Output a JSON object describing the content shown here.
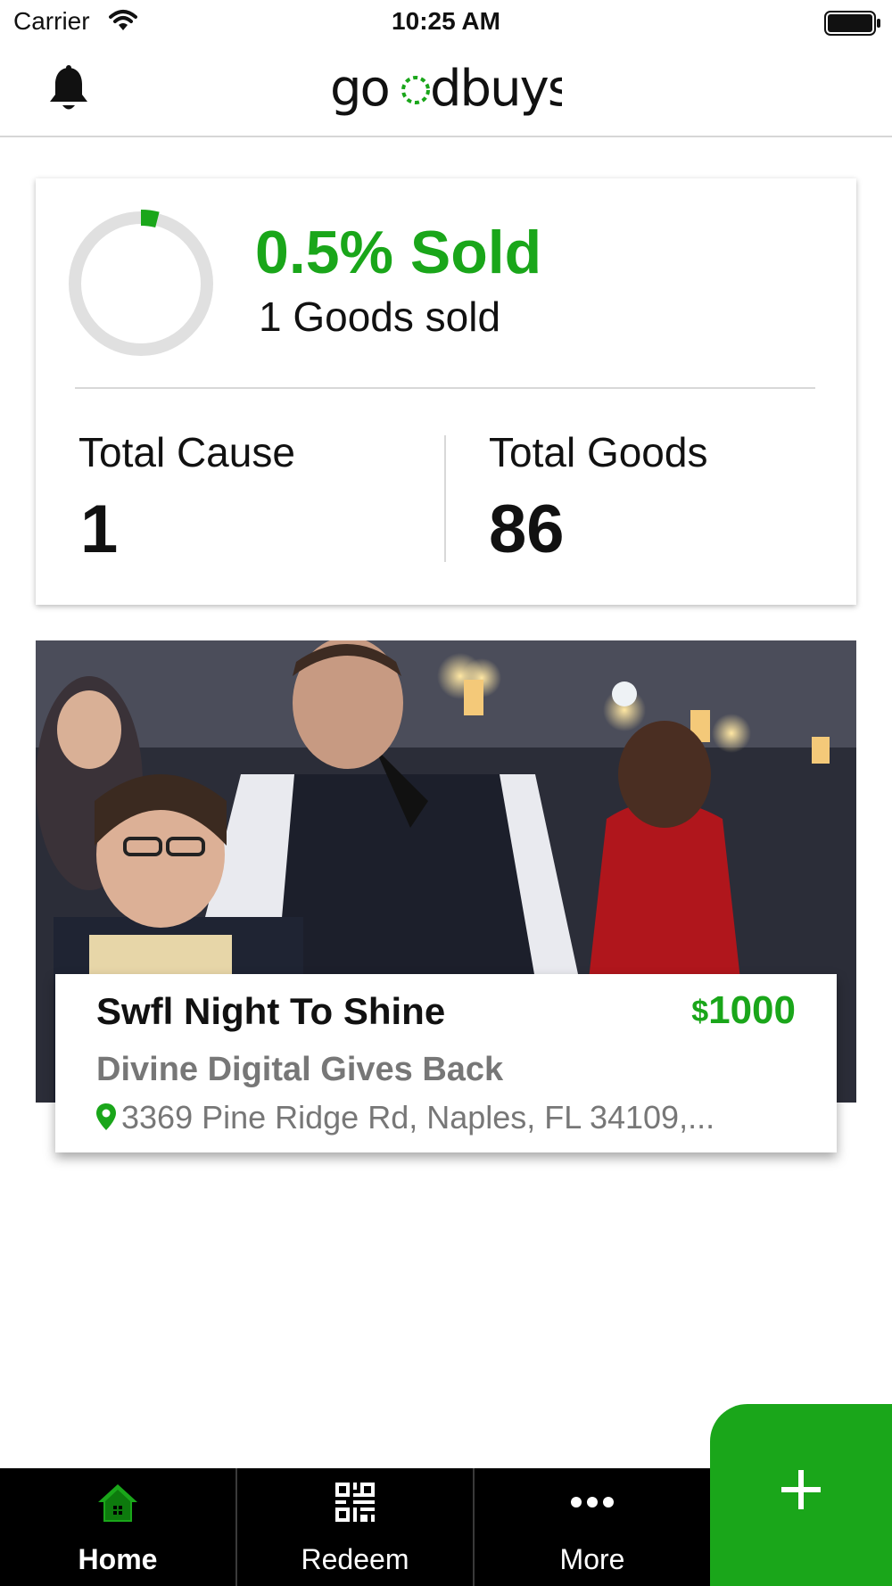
{
  "status_bar": {
    "carrier": "Carrier",
    "time": "10:25 AM"
  },
  "nav": {
    "logo_text": "goodbuys"
  },
  "stats": {
    "sold_percent_text": "0.5% Sold",
    "sold_fraction": 0.005,
    "goods_sold_text": "1 Goods sold",
    "total_cause_label": "Total Cause",
    "total_cause_value": "1",
    "total_goods_label": "Total Goods",
    "total_goods_value": "86"
  },
  "campaign": {
    "title": "Swfl Night To Shine",
    "price_symbol": "$",
    "price": "1000",
    "organization": "Divine Digital Gives Back",
    "address": "3369 Pine Ridge Rd, Naples, FL 34109,..."
  },
  "tabs": [
    {
      "label": "Home",
      "icon": "home-icon",
      "active": true
    },
    {
      "label": "Redeem",
      "icon": "qr-code-icon",
      "active": false
    },
    {
      "label": "More",
      "icon": "more-dots-icon",
      "active": false
    }
  ],
  "colors": {
    "accent": "#1aa61a",
    "tab_bar": "#000000",
    "ring_track": "#e0e0e0"
  }
}
